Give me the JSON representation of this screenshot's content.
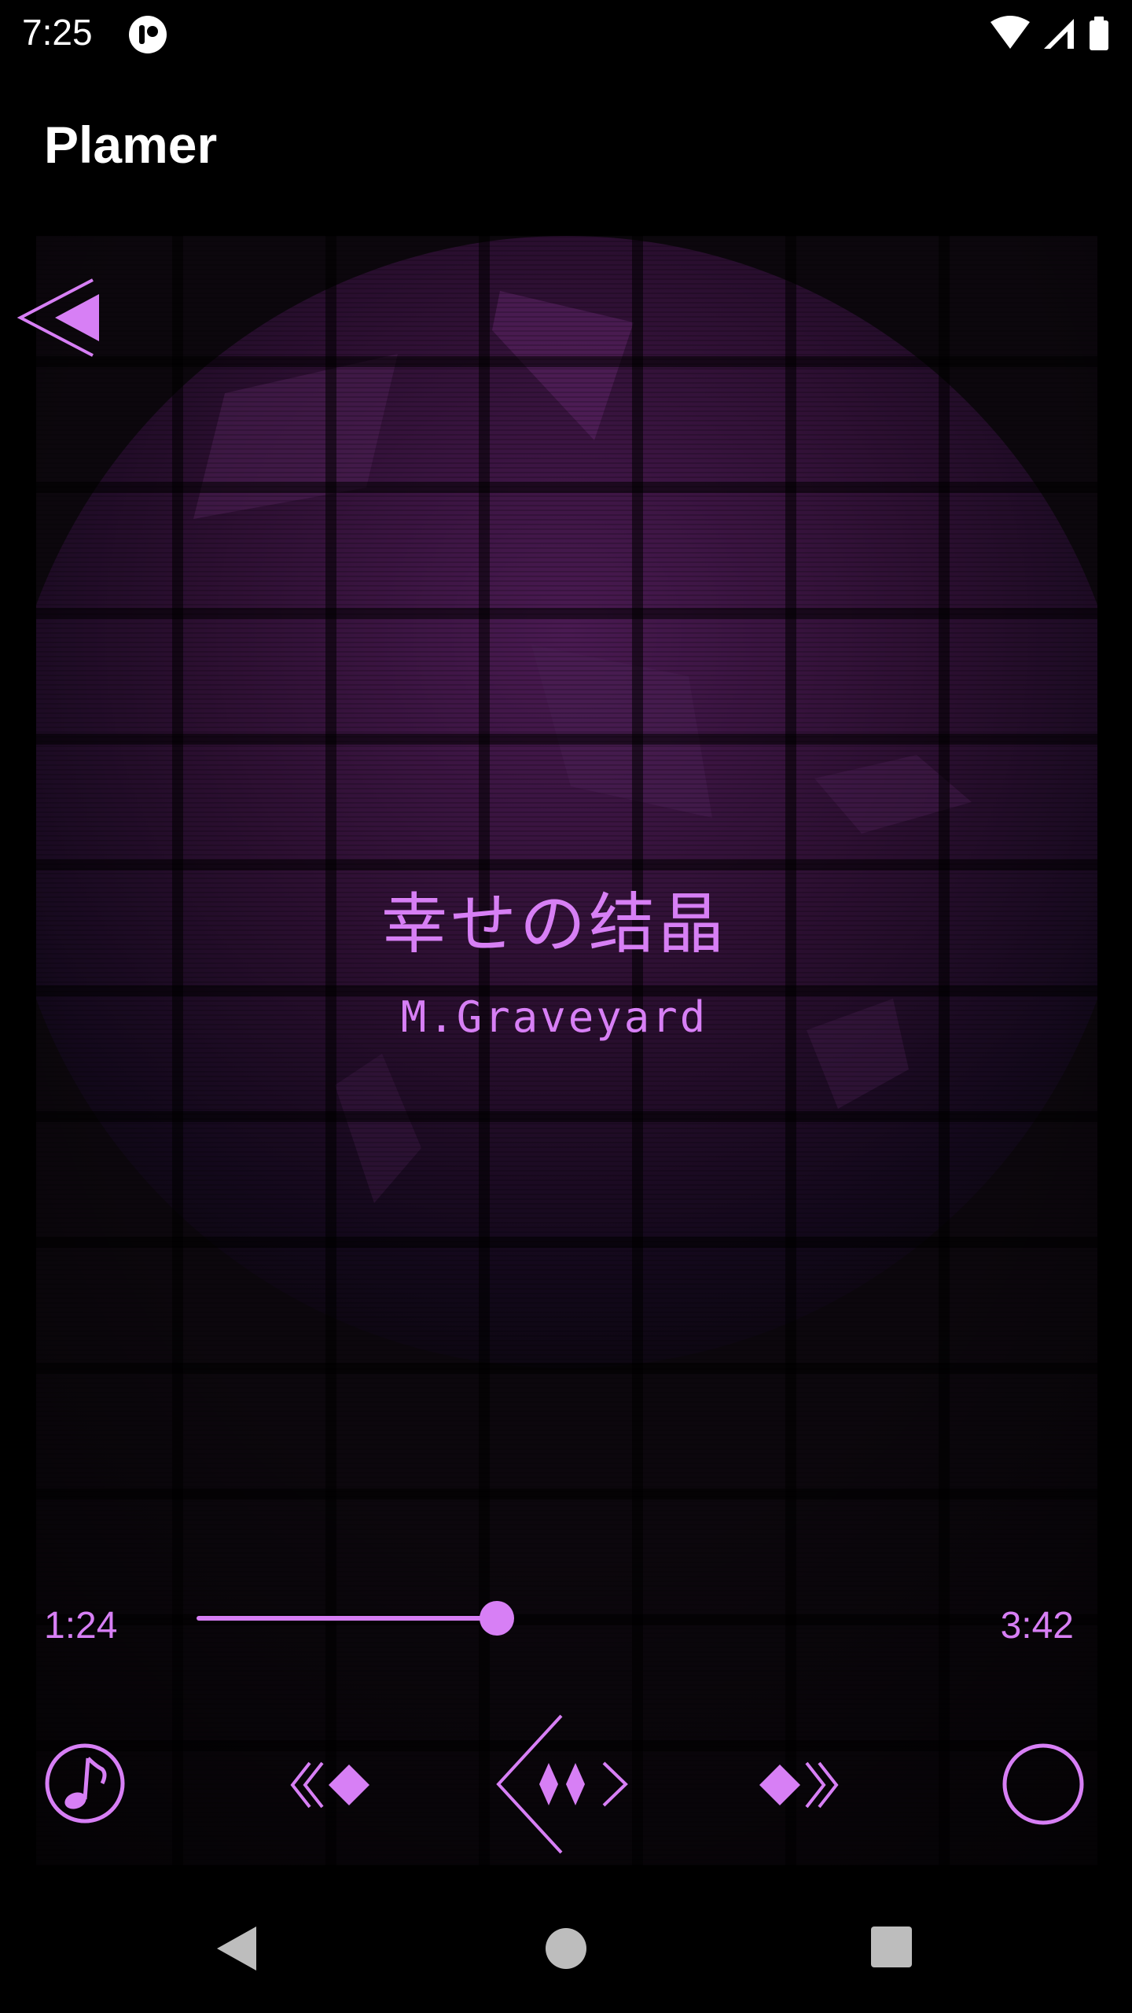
{
  "status_bar": {
    "time": "7:25"
  },
  "app_bar": {
    "title": "Plamer"
  },
  "player": {
    "song_title": "幸せの结晶",
    "artist": "M.Graveyard",
    "time_current": "1:24",
    "time_total": "3:42",
    "progress_fraction": 0.378
  },
  "colors": {
    "accent": "#d77ff5",
    "background": "#000000",
    "stage_background": "#0c070d",
    "glow": "#5a1f63"
  },
  "icons": {
    "back": "back-triangle-icon",
    "playlist": "music-note-icon",
    "previous": "diamond-previous-icon",
    "play_pause": "diamond-pause-icon",
    "next": "diamond-next-icon",
    "mode": "circle-mode-icon"
  }
}
